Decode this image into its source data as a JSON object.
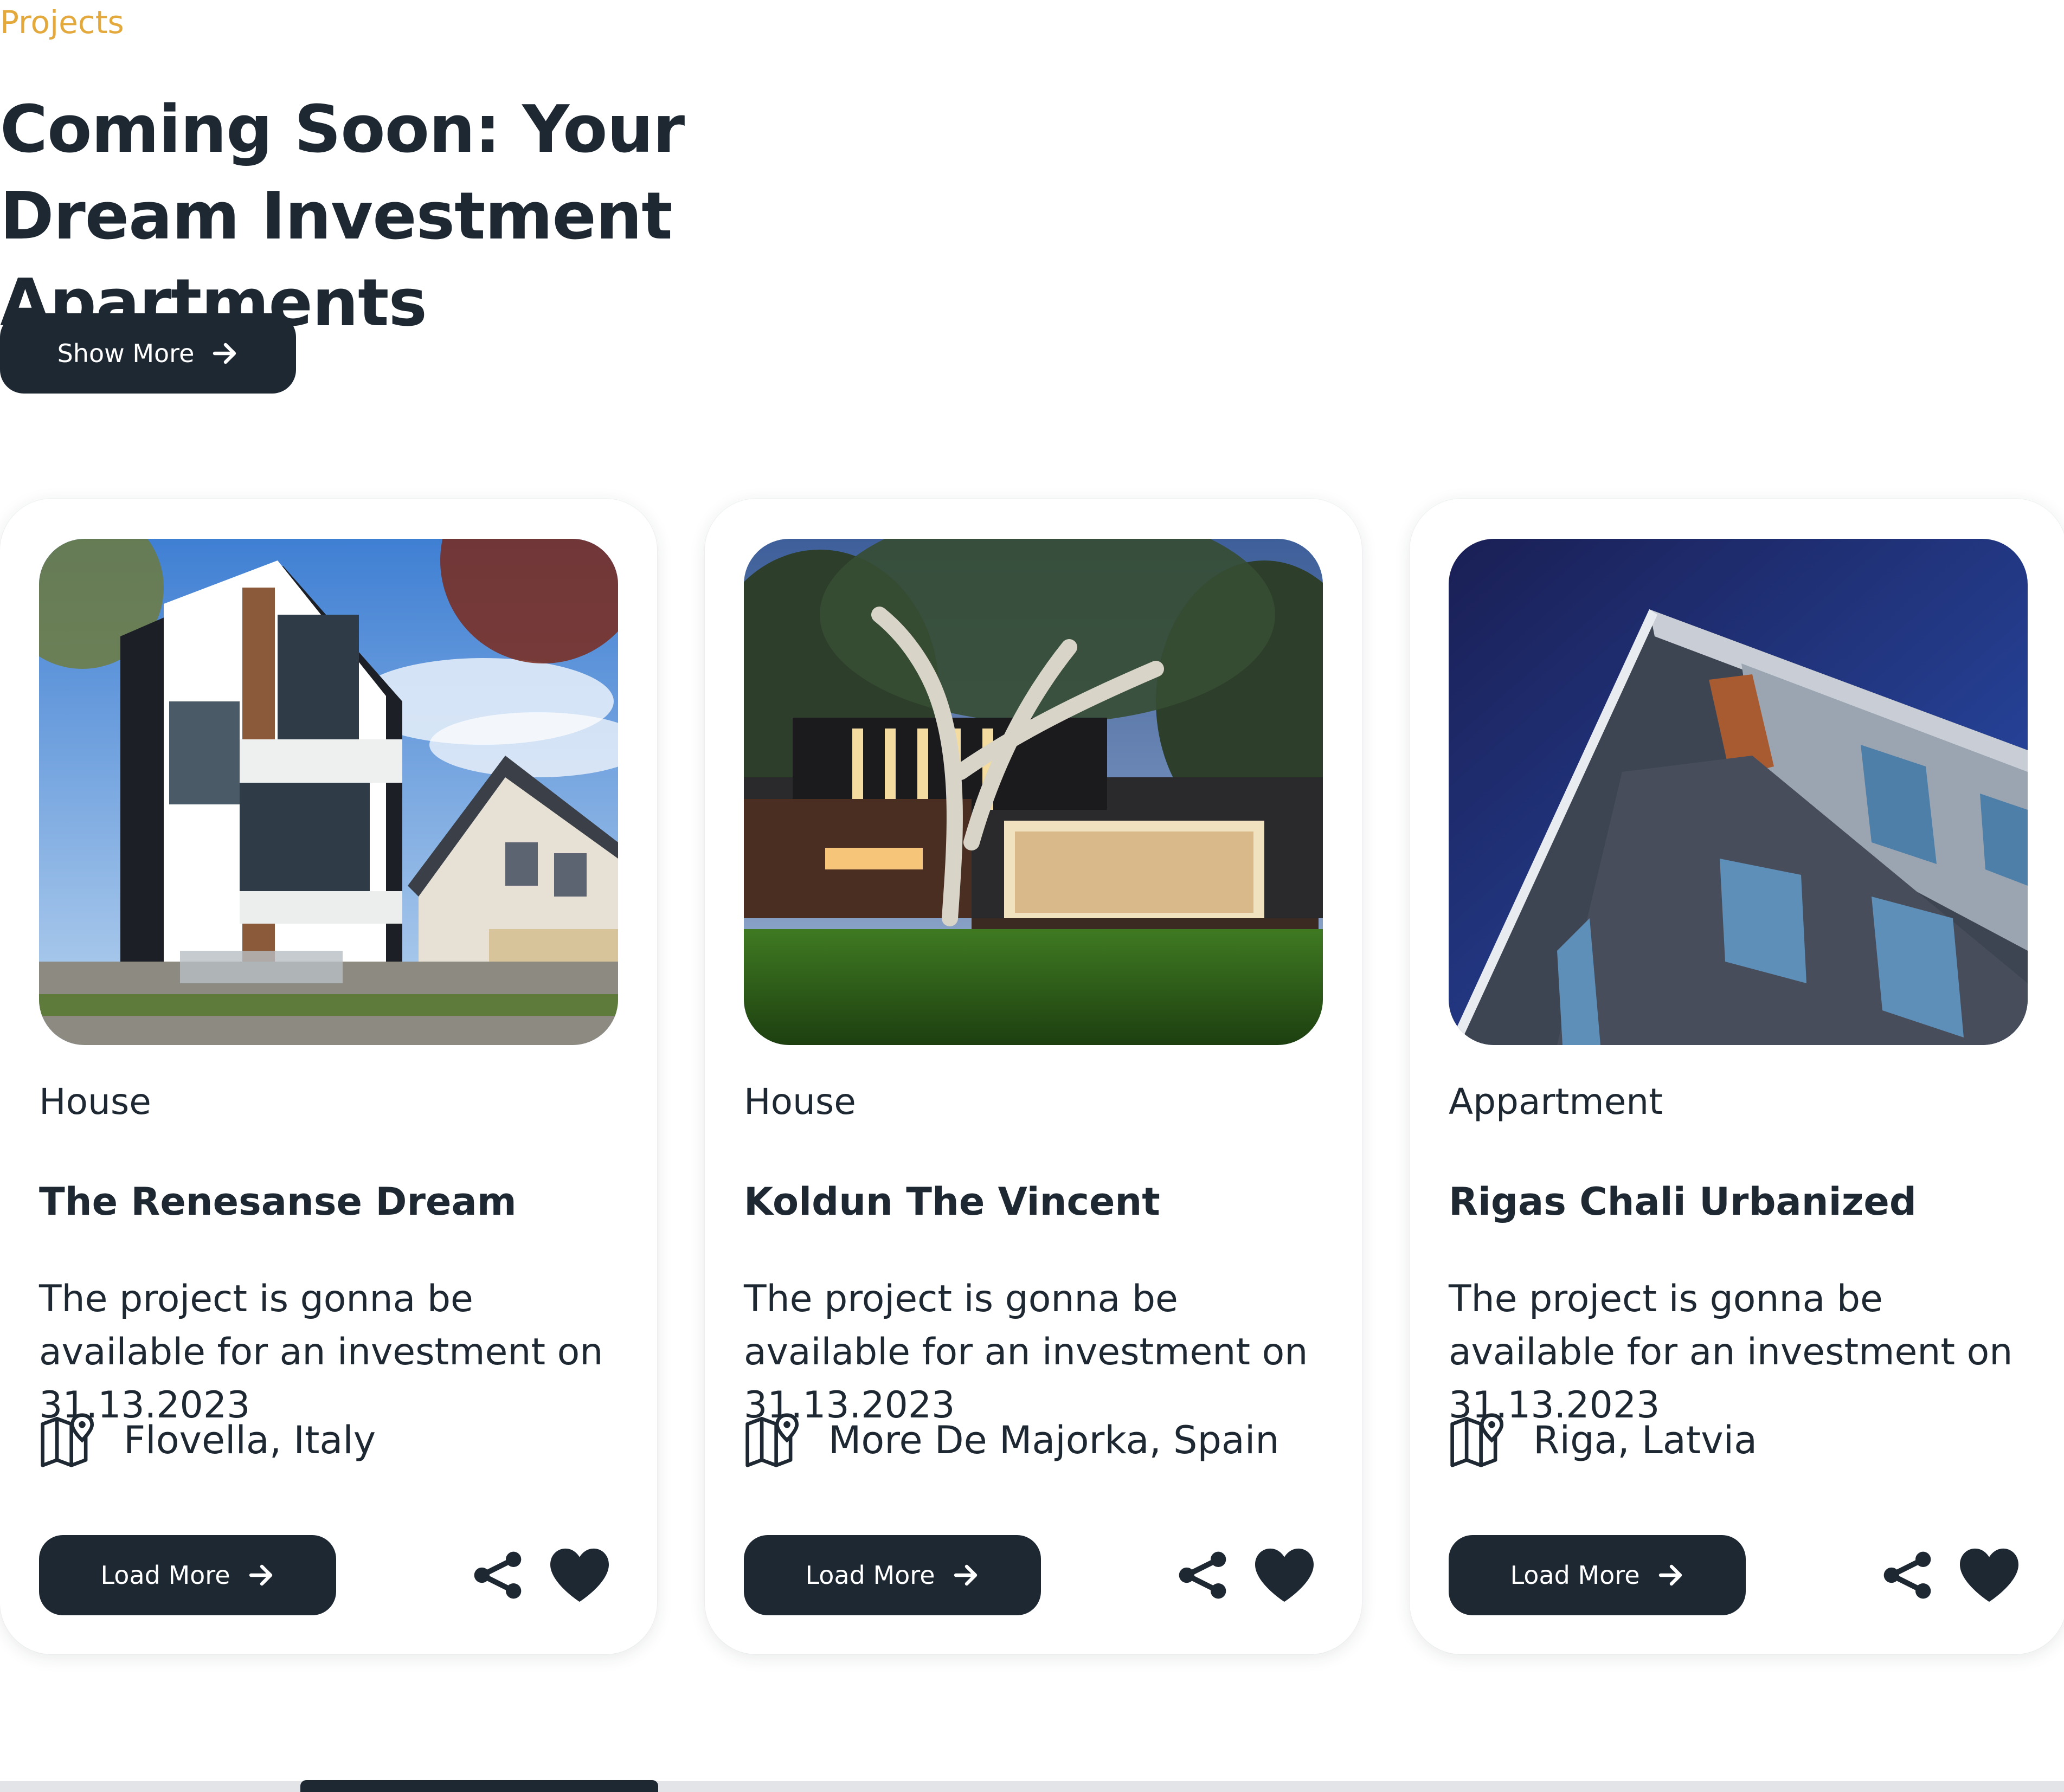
{
  "section": {
    "eyebrow": "Projects",
    "headline": "Coming Soon: Your Dream Investment Apartments",
    "show_more_label": "Show More"
  },
  "cards": [
    {
      "category": "House",
      "title": "The Renesanse Dream",
      "description": "The project is gonna be available for an investment on 31.13.2023",
      "location": "Flovella, Italy",
      "button_label": "Load More",
      "image": "modern-house-photo"
    },
    {
      "category": "House",
      "title": "Koldun The Vincent",
      "description": "The project is gonna be available for an investment on 31.13.2023",
      "location": "More De Majorka, Spain",
      "button_label": "Load More",
      "image": "house-at-dusk-photo"
    },
    {
      "category": "Appartment",
      "title": "Rigas Chali Urbanized",
      "description": "The project is gonna be available for an investment on 31.13.2023",
      "location": "Riga, Latvia",
      "button_label": "Load More",
      "image": "apartment-building-photo"
    }
  ],
  "icons": {
    "location": "map-pin-icon",
    "share": "share-icon",
    "favorite": "heart-icon",
    "arrow": "arrow-right-icon"
  },
  "colors": {
    "accent": "#e3a93c",
    "primary_dark": "#1e2833",
    "card_bg": "#ffffff",
    "scroll_track": "#e2e4e7"
  }
}
